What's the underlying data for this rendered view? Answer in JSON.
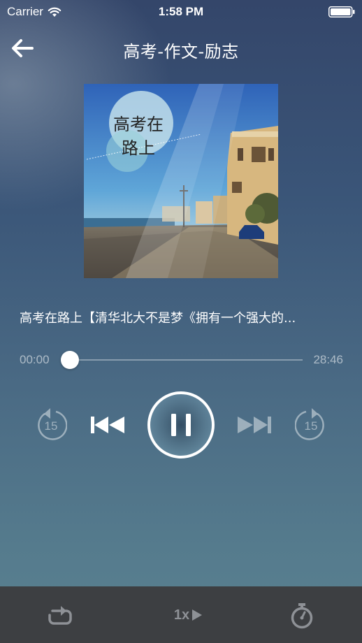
{
  "status_bar": {
    "carrier": "Carrier",
    "time": "1:58 PM"
  },
  "nav": {
    "title": "高考-作文-励志"
  },
  "cover": {
    "text_line1": "高考在",
    "text_line2": "路上"
  },
  "track": {
    "title": "高考在路上【清华北大不是梦《拥有一个强大的..."
  },
  "progress": {
    "current": "00:00",
    "total": "28:46",
    "fraction": 0.0
  },
  "controls": {
    "rewind_seconds": "15",
    "forward_seconds": "15",
    "state": "playing"
  },
  "bottom_bar": {
    "speed": "1x"
  },
  "colors": {
    "background_top": "#34466a",
    "background_bottom": "#5a8190",
    "bottom_bar": "#3d3f42",
    "icon_dim": "#8e9196"
  }
}
